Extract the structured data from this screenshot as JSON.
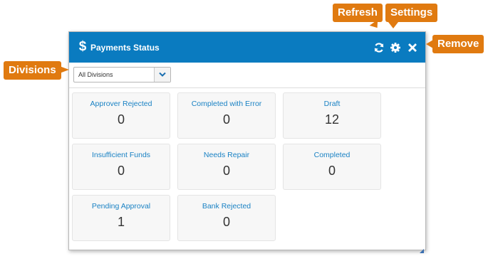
{
  "widget": {
    "title": "Payments Status",
    "header_icons": [
      "dollar-icon",
      "refresh-icon",
      "gear-icon",
      "close-icon"
    ],
    "accent_color": "#0a7bc0",
    "divisions": {
      "selected": "All Divisions"
    },
    "tiles": [
      {
        "label": "Approver Rejected",
        "value": "0"
      },
      {
        "label": "Completed with Error",
        "value": "0"
      },
      {
        "label": "Draft",
        "value": "12"
      },
      {
        "label": "Insufficient Funds",
        "value": "0"
      },
      {
        "label": "Needs Repair",
        "value": "0"
      },
      {
        "label": "Completed",
        "value": "0"
      },
      {
        "label": "Pending Approval",
        "value": "1"
      },
      {
        "label": "Bank Rejected",
        "value": "0"
      }
    ]
  },
  "callouts": {
    "refresh": "Refresh",
    "settings": "Settings",
    "remove": "Remove",
    "divisions": "Divisions",
    "color": "#e07a10"
  }
}
